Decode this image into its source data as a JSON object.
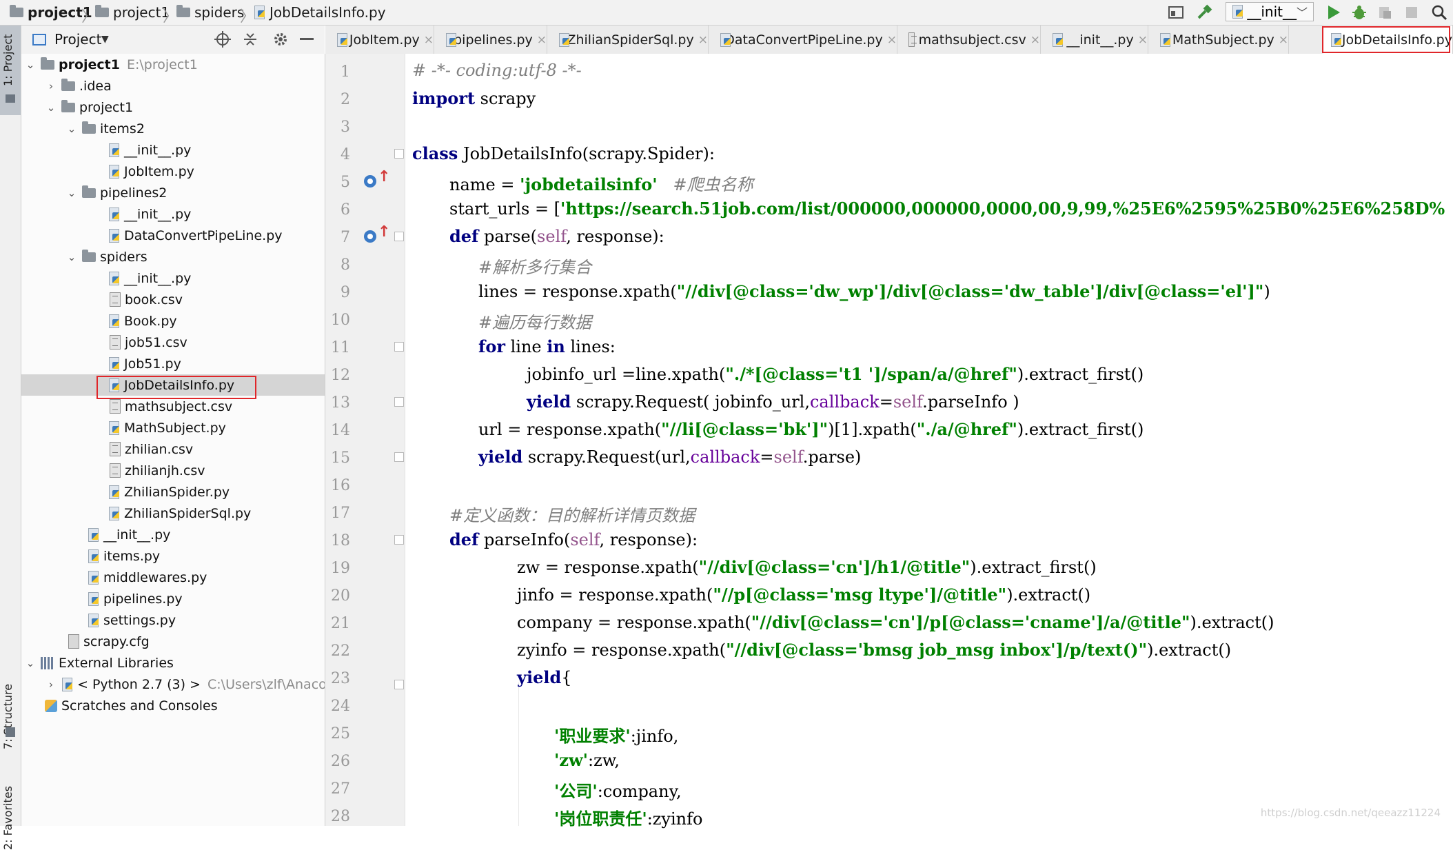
{
  "breadcrumb": {
    "items": [
      "project1",
      "project1",
      "spiders",
      "JobDetailsInfo.py"
    ]
  },
  "toolbar": {
    "run_config": "__init__",
    "icons": [
      "layout-icon",
      "hammer-icon",
      "python-icon",
      "chevron-down-icon",
      "run-icon",
      "debug-icon",
      "coverage-icon",
      "stop-icon",
      "search-icon"
    ]
  },
  "tool_strip": {
    "project_tab": "1: Project",
    "structure_tab": "7: Structure",
    "favorites_tab": "2: Favorites"
  },
  "project_panel": {
    "title": "Project",
    "root_name": "project1",
    "root_path": "E:\\project1",
    "tree": [
      {
        "label": "project1",
        "type": "root"
      },
      {
        "label": ".idea",
        "type": "folder"
      },
      {
        "label": "project1",
        "type": "folder"
      },
      {
        "label": "items2",
        "type": "folder"
      },
      {
        "label": "__init__.py",
        "type": "py"
      },
      {
        "label": "JobItem.py",
        "type": "py"
      },
      {
        "label": "pipelines2",
        "type": "folder"
      },
      {
        "label": "__init__.py",
        "type": "py"
      },
      {
        "label": "DataConvertPipeLine.py",
        "type": "py"
      },
      {
        "label": "spiders",
        "type": "folder"
      },
      {
        "label": "__init__.py",
        "type": "py"
      },
      {
        "label": "book.csv",
        "type": "csv"
      },
      {
        "label": "Book.py",
        "type": "py"
      },
      {
        "label": "job51.csv",
        "type": "csv"
      },
      {
        "label": "Job51.py",
        "type": "py"
      },
      {
        "label": "JobDetailsInfo.py",
        "type": "py"
      },
      {
        "label": "mathsubject.csv",
        "type": "csv"
      },
      {
        "label": "MathSubject.py",
        "type": "py"
      },
      {
        "label": "zhilian.csv",
        "type": "csv"
      },
      {
        "label": "zhilianjh.csv",
        "type": "csv"
      },
      {
        "label": "ZhilianSpider.py",
        "type": "py"
      },
      {
        "label": "ZhilianSpiderSql.py",
        "type": "py"
      },
      {
        "label": "__init__.py",
        "type": "py"
      },
      {
        "label": "items.py",
        "type": "py"
      },
      {
        "label": "middlewares.py",
        "type": "py"
      },
      {
        "label": "pipelines.py",
        "type": "py"
      },
      {
        "label": "settings.py",
        "type": "py"
      },
      {
        "label": "scrapy.cfg",
        "type": "cfg"
      },
      {
        "label": "External Libraries",
        "type": "lib"
      },
      {
        "label": "< Python 2.7 (3) >",
        "type": "python",
        "path": "C:\\Users\\zlf\\Anacond"
      },
      {
        "label": "Scratches and Consoles",
        "type": "scratch"
      }
    ]
  },
  "tabs": [
    {
      "label": "JobItem.py"
    },
    {
      "label": "pipelines.py"
    },
    {
      "label": "ZhilianSpiderSql.py"
    },
    {
      "label": "DataConvertPipeLine.py"
    },
    {
      "label": "mathsubject.csv"
    },
    {
      "label": "__init__.py"
    },
    {
      "label": "MathSubject.py"
    },
    {
      "label": "JobDetailsInfo.py"
    }
  ],
  "editor": {
    "line_numbers": [
      "1",
      "2",
      "3",
      "4",
      "5",
      "6",
      "7",
      "8",
      "9",
      "10",
      "11",
      "12",
      "13",
      "14",
      "15",
      "16",
      "17",
      "18",
      "19",
      "20",
      "21",
      "22",
      "23",
      "24",
      "25",
      "26",
      "27",
      "28"
    ],
    "code": {
      "l1": "# -*- coding:utf-8 -*-",
      "l2_kw": "import",
      "l2_rest": " scrapy",
      "l4_kw": "class",
      "l4_rest": " JobDetailsInfo(scrapy.Spider):",
      "l5_a": "name = ",
      "l5_str": "'jobdetailsinfo'",
      "l5_cmt": "   #爬虫名称",
      "l6_a": "start_urls = [",
      "l6_str": "'https://search.51job.com/list/000000,000000,0000,00,9,99,%25E6%2595%25B0%25E6%258D%",
      "l7_kw": "def",
      "l7_a": " parse(",
      "l7_self": "self",
      "l7_b": ", response):",
      "l8": "#解析多行集合",
      "l9_a": "lines = response.xpath(",
      "l9_str": "\"//div[@class='dw_wp']/div[@class='dw_table']/div[@class='el']\"",
      "l9_b": ")",
      "l10": "#遍历每行数据",
      "l11_kw1": "for",
      "l11_a": " line ",
      "l11_kw2": "in",
      "l11_b": " lines:",
      "l12_a": "jobinfo_url =line.xpath(",
      "l12_str": "\"./*[@class='t1 ']/span/a/@href\"",
      "l12_b": ").extract_first()",
      "l13_kw": "yield",
      "l13_a": " scrapy.Request( jobinfo_url,",
      "l13_kwarg": "callback",
      "l13_b": "=",
      "l13_self": "self",
      "l13_c": ".parseInfo )",
      "l14_a": "url = response.xpath(",
      "l14_str": "\"//li[@class='bk']\"",
      "l14_b": ")[1].xpath(",
      "l14_str2": "\"./a/@href\"",
      "l14_c": ").extract_first()",
      "l15_kw": "yield",
      "l15_a": " scrapy.Request(url,",
      "l15_kwarg": "callback",
      "l15_b": "=",
      "l15_self": "self",
      "l15_c": ".parse)",
      "l17": "#定义函数：目的解析详情页数据",
      "l18_kw": "def",
      "l18_a": " parseInfo(",
      "l18_self": "self",
      "l18_b": ", response):",
      "l19_a": "zw = response.xpath(",
      "l19_str": "\"//div[@class='cn']/h1/@title\"",
      "l19_b": ").extract_first()",
      "l20_a": "jinfo = response.xpath(",
      "l20_str": "\"//p[@class='msg ltype']/@title\"",
      "l20_b": ").extract()",
      "l21_a": "company = response.xpath(",
      "l21_str": "\"//div[@class='cn']/p[@class='cname']/a/@title\"",
      "l21_b": ").extract()",
      "l22_a": "zyinfo = response.xpath(",
      "l22_str": "\"//div[@class='bmsg job_msg inbox']/p/text()\"",
      "l22_b": ").extract()",
      "l23_kw": "yield",
      "l23_a": "{",
      "l25_str": "'职业要求'",
      "l25_a": ":jinfo,",
      "l26_str": "'zw'",
      "l26_a": ":zw,",
      "l27_str": "'公司'",
      "l27_a": ":company,",
      "l28_str": "'岗位职责任'",
      "l28_a": ":zyinfo"
    }
  },
  "watermark": "https://blog.csdn.net/qeeazz11224",
  "colors": {
    "keyword": "#000080",
    "string": "#008000",
    "comment": "#808080",
    "self": "#94558d",
    "highlight_box": "#e0262a"
  }
}
